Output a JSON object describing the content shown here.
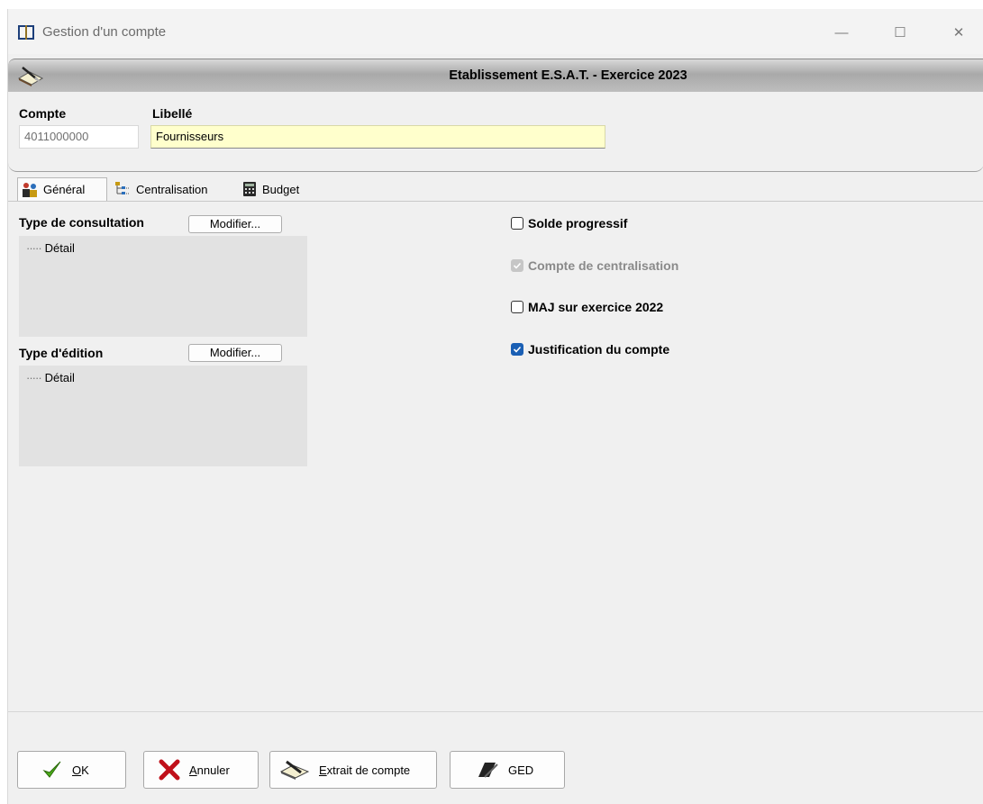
{
  "window": {
    "title": "Gestion d'un compte",
    "minimize_glyph": "—",
    "maximize_glyph": "☐",
    "close_glyph": "✕"
  },
  "header": {
    "title": "Etablissement E.S.A.T. - Exercice 2023"
  },
  "account": {
    "compte_label": "Compte",
    "compte_value": "4011000000",
    "libelle_label": "Libellé",
    "libelle_value": "Fournisseurs"
  },
  "tabs": [
    {
      "label": "Général",
      "icon": "users-icon",
      "active": true
    },
    {
      "label": "Centralisation",
      "icon": "hierarchy-icon",
      "active": false
    },
    {
      "label": "Budget",
      "icon": "calculator-icon",
      "active": false
    }
  ],
  "general": {
    "consultation": {
      "label": "Type de consultation",
      "button": "Modifier...",
      "tree": [
        "Détail"
      ]
    },
    "edition": {
      "label": "Type d'édition",
      "button": "Modifier...",
      "tree": [
        "Détail"
      ]
    },
    "options": [
      {
        "label": "Solde progressif",
        "checked": false,
        "disabled": false
      },
      {
        "label": "Compte de centralisation",
        "checked": true,
        "disabled": true
      },
      {
        "label": "MAJ sur exercice 2022",
        "checked": false,
        "disabled": false
      },
      {
        "label": "Justification du compte",
        "checked": true,
        "disabled": false
      }
    ]
  },
  "actions": {
    "ok": {
      "mnemonic": "O",
      "rest": "K"
    },
    "annuler": {
      "mnemonic": "A",
      "rest": "nnuler"
    },
    "extrait": {
      "mnemonic": "E",
      "rest": "xtrait de compte"
    },
    "ged": {
      "label": "GED"
    }
  },
  "colors": {
    "checkbox_checked": "#1a5fb4",
    "field_editable": "#ffffcc",
    "window_bg": "#f0f0f0"
  }
}
